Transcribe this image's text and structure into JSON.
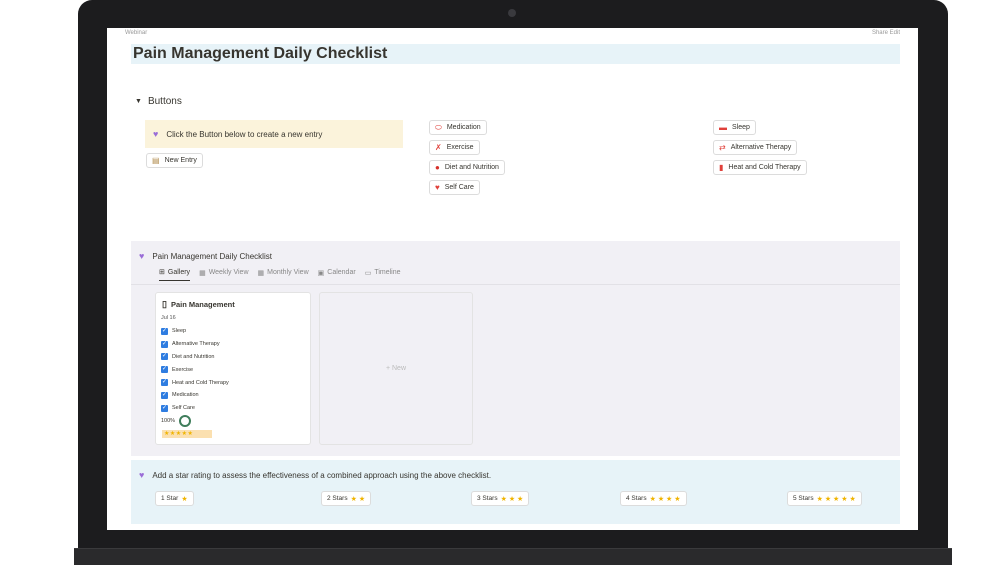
{
  "page": {
    "title": "Pain Management Daily Checklist",
    "crumb_left": "Webinar",
    "crumb_right": "Share Edit"
  },
  "buttons_section": {
    "toggle_label": "Buttons",
    "callout_text": "Click the Button below to create a new entry",
    "new_entry": "New Entry",
    "col1": [
      "Medication",
      "Exercise",
      "Diet and Nutrition",
      "Self Care"
    ],
    "col2": [
      "Sleep",
      "Alternative Therapy",
      "Heat and Cold Therapy"
    ]
  },
  "database": {
    "title": "Pain Management Daily Checklist",
    "tabs": [
      "Gallery",
      "Weekly View",
      "Monthly View",
      "Calendar",
      "Timeline"
    ],
    "card": {
      "title": "Pain Management",
      "date": "Jul 16",
      "items": [
        "Sleep",
        "Alternative Therapy",
        "Diet and Nutrition",
        "Exercise",
        "Heat and Cold Therapy",
        "Medication",
        "Self Care"
      ],
      "percent": "100%",
      "stars": "★★★★★"
    },
    "new_label": "+ New"
  },
  "rating": {
    "text": "Add a star rating to assess the effectiveness of a combined approach using the above checklist.",
    "buttons": [
      {
        "label": "1 Star",
        "stars": "★"
      },
      {
        "label": "2 Stars",
        "stars": "★ ★"
      },
      {
        "label": "3 Stars",
        "stars": "★ ★ ★"
      },
      {
        "label": "4 Stars",
        "stars": "★ ★ ★ ★"
      },
      {
        "label": "5 Stars",
        "stars": "★ ★ ★ ★ ★"
      }
    ]
  },
  "colors": {
    "accent": "#9a6dd7",
    "title_bg": "#e7f3f8",
    "callout_bg": "#fbf3db",
    "star": "#f0b400"
  },
  "icons": {
    "callout": "purple-heart-icon",
    "medication": "pill-icon",
    "exercise": "person-running-icon",
    "diet": "apple-icon",
    "self_care": "heart-icon",
    "sleep": "bed-icon",
    "alt_therapy": "swap-arrows-icon",
    "heat_cold": "thermometer-icon"
  }
}
